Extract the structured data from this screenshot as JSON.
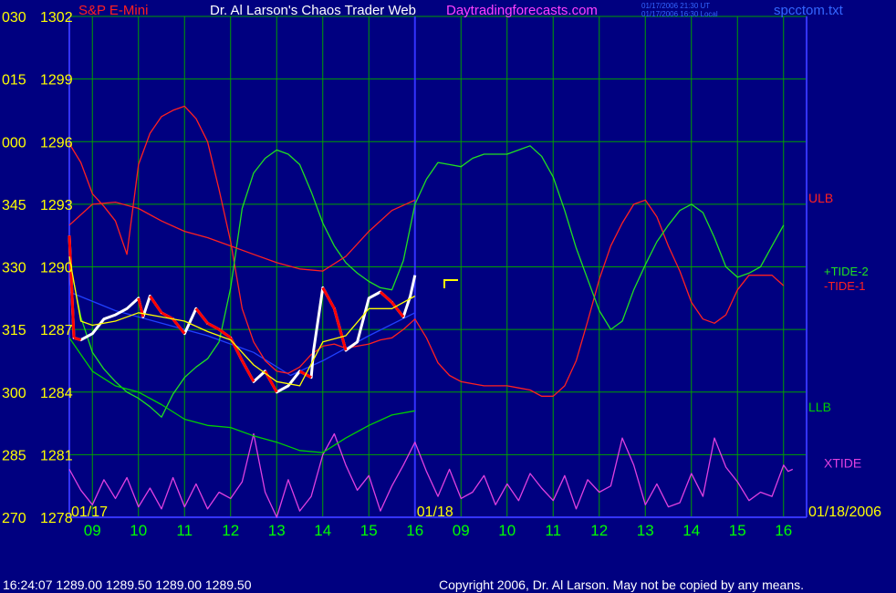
{
  "header": {
    "instrument": "S&P E-Mini",
    "title": "Dr. Al Larson's Chaos Trader Web",
    "site": "Daytradingforecasts.com",
    "stamp_ut": "01/17/2006 21:30 UT",
    "stamp_local": "01/17/2006 16:30 Local",
    "file": "spcctom.txt"
  },
  "footer": {
    "quote": "16:24:07   1289.00 1289.50 1289.00 1289.50",
    "copyright": "Copyright 2006, Dr. Al Larson. May not be copied by any means."
  },
  "colors": {
    "background": "#000080",
    "grid": "#00a000",
    "axis": "#3333ff",
    "price_up": "#ffffff",
    "price_down": "#ff0000",
    "ulb": "#ff2020",
    "llb": "#00d000",
    "tide_plus": "#20e020",
    "tide_minus": "#ff2020",
    "xtide": "#e040e0",
    "moving_avg": "#ffff00",
    "trend": "#2040ff",
    "label_yellow": "#ffff00",
    "label_white": "#ffffff",
    "label_green": "#00ff00",
    "title_magenta": "#ff40ff"
  },
  "chart_data": {
    "type": "line",
    "ylim": [
      1278,
      1302
    ],
    "y_ticks": [
      {
        "angle": "030",
        "price": "1302"
      },
      {
        "angle": "015",
        "price": "1299"
      },
      {
        "angle": "000",
        "price": "1296"
      },
      {
        "angle": "345",
        "price": "1293"
      },
      {
        "angle": "330",
        "price": "1290"
      },
      {
        "angle": "315",
        "price": "1287"
      },
      {
        "angle": "300",
        "price": "1284"
      },
      {
        "angle": "285",
        "price": "1281"
      },
      {
        "angle": "270",
        "price": "1278"
      }
    ],
    "xlim": [
      8.5,
      24.5
    ],
    "x_ticks": [
      {
        "x": 9,
        "label": "09"
      },
      {
        "x": 10,
        "label": "10"
      },
      {
        "x": 11,
        "label": "11"
      },
      {
        "x": 12,
        "label": "12"
      },
      {
        "x": 13,
        "label": "13"
      },
      {
        "x": 14,
        "label": "14"
      },
      {
        "x": 15,
        "label": "15"
      },
      {
        "x": 16,
        "label": "16"
      },
      {
        "x": 17,
        "label": "09"
      },
      {
        "x": 18,
        "label": "10"
      },
      {
        "x": 19,
        "label": "11"
      },
      {
        "x": 20,
        "label": "12"
      },
      {
        "x": 21,
        "label": "13"
      },
      {
        "x": 22,
        "label": "14"
      },
      {
        "x": 23,
        "label": "15"
      },
      {
        "x": 24,
        "label": "16"
      }
    ],
    "day_labels": [
      {
        "x": 8.5,
        "label": "01/17"
      },
      {
        "x": 16,
        "label": "01/18"
      },
      {
        "x": 24.5,
        "label": "01/18/2006"
      }
    ],
    "legend_labels": [
      {
        "name": "ULB",
        "y": 1293.3
      },
      {
        "name": "+TIDE-2",
        "y": 1289.8
      },
      {
        "name": "-TIDE-1",
        "y": 1289.4
      },
      {
        "name": "LLB",
        "y": 1283.3
      },
      {
        "name": "XTIDE",
        "y": 1280.6
      }
    ],
    "series": [
      {
        "name": "ULB",
        "x": [
          8.5,
          9,
          9.5,
          10,
          10.5,
          11,
          11.5,
          12,
          12.5,
          13,
          13.5,
          14,
          14.5,
          15,
          15.5,
          16
        ],
        "y": [
          1292.0,
          1293.0,
          1293.1,
          1292.8,
          1292.2,
          1291.7,
          1291.4,
          1291.0,
          1290.6,
          1290.2,
          1289.9,
          1289.8,
          1290.5,
          1291.7,
          1292.7,
          1293.2
        ]
      },
      {
        "name": "LLB",
        "x": [
          8.5,
          9,
          9.5,
          10,
          10.5,
          11,
          11.5,
          12,
          12.5,
          13,
          13.5,
          14,
          14.5,
          15,
          15.5,
          16
        ],
        "y": [
          1286.6,
          1285.0,
          1284.3,
          1284.0,
          1283.4,
          1282.7,
          1282.4,
          1282.3,
          1281.9,
          1281.6,
          1281.2,
          1281.1,
          1281.8,
          1282.4,
          1282.9,
          1283.1
        ]
      },
      {
        "name": "+TIDE-2",
        "x": [
          8.5,
          8.75,
          9,
          9.25,
          9.5,
          9.75,
          10,
          10.25,
          10.5,
          10.75,
          11,
          11.25,
          11.5,
          11.75,
          12,
          12.25,
          12.5,
          12.75,
          13,
          13.25,
          13.5,
          13.75,
          14,
          14.25,
          14.5,
          14.75,
          15,
          15.25,
          15.5,
          15.75,
          16,
          16.25,
          16.5,
          16.75,
          17,
          17.25,
          17.5,
          17.75,
          18,
          18.25,
          18.5,
          18.75,
          19,
          19.25,
          19.5,
          19.75,
          20,
          20.25,
          20.5,
          20.75,
          21,
          21.25,
          21.5,
          21.75,
          22,
          22.25,
          22.5,
          22.75,
          23,
          23.25,
          23.5,
          23.75,
          24
        ],
        "y": [
          1290.3,
          1287.6,
          1285.9,
          1285.1,
          1284.5,
          1284.0,
          1283.7,
          1283.3,
          1282.8,
          1283.9,
          1284.7,
          1285.2,
          1285.6,
          1286.4,
          1289.0,
          1292.8,
          1294.5,
          1295.2,
          1295.6,
          1295.4,
          1294.9,
          1293.6,
          1292.1,
          1291.0,
          1290.2,
          1289.7,
          1289.3,
          1289.0,
          1288.9,
          1290.3,
          1293.0,
          1294.2,
          1295.0,
          1294.9,
          1294.8,
          1295.2,
          1295.4,
          1295.4,
          1295.4,
          1295.6,
          1295.8,
          1295.3,
          1294.3,
          1292.7,
          1290.9,
          1289.4,
          1287.9,
          1287.0,
          1287.4,
          1288.9,
          1290.1,
          1291.2,
          1292.0,
          1292.7,
          1293.0,
          1292.6,
          1291.4,
          1290.0,
          1289.5,
          1289.7,
          1290.0,
          1291.0,
          1292.0
        ]
      },
      {
        "name": "-TIDE-1",
        "x": [
          8.5,
          8.75,
          9,
          9.25,
          9.5,
          9.75,
          10,
          10.25,
          10.5,
          10.75,
          11,
          11.25,
          11.5,
          11.75,
          12,
          12.25,
          12.5,
          12.75,
          13,
          13.25,
          13.5,
          13.75,
          14,
          14.25,
          14.5,
          14.75,
          15,
          15.25,
          15.5,
          15.75,
          16,
          16.25,
          16.5,
          16.75,
          17,
          17.25,
          17.5,
          17.75,
          18,
          18.25,
          18.5,
          18.75,
          19,
          19.25,
          19.5,
          19.75,
          20,
          20.25,
          20.5,
          20.75,
          21,
          21.25,
          21.5,
          21.75,
          22,
          22.25,
          22.5,
          22.75,
          23,
          23.25,
          23.5,
          23.75,
          24
        ],
        "y": [
          1295.9,
          1295.0,
          1293.5,
          1292.9,
          1292.2,
          1290.6,
          1294.9,
          1296.4,
          1297.2,
          1297.5,
          1297.7,
          1297.1,
          1296.0,
          1293.7,
          1291.2,
          1288.0,
          1286.4,
          1285.5,
          1285.0,
          1284.9,
          1285.2,
          1285.8,
          1286.2,
          1286.3,
          1286.1,
          1286.2,
          1286.3,
          1286.5,
          1286.6,
          1287.0,
          1287.5,
          1286.6,
          1285.4,
          1284.8,
          1284.5,
          1284.4,
          1284.3,
          1284.3,
          1284.3,
          1284.2,
          1284.1,
          1283.8,
          1283.8,
          1284.3,
          1285.5,
          1287.4,
          1289.4,
          1291.0,
          1292.1,
          1293.0,
          1293.2,
          1292.4,
          1291.0,
          1289.8,
          1288.3,
          1287.5,
          1287.3,
          1287.7,
          1288.9,
          1289.6,
          1289.6,
          1289.6,
          1289.1
        ]
      },
      {
        "name": "XTIDE",
        "x": [
          8.5,
          8.75,
          9,
          9.25,
          9.5,
          9.75,
          10,
          10.25,
          10.5,
          10.75,
          11,
          11.25,
          11.5,
          11.75,
          12,
          12.25,
          12.5,
          12.75,
          13,
          13.25,
          13.5,
          13.75,
          14,
          14.25,
          14.5,
          14.75,
          15,
          15.25,
          15.5,
          15.75,
          16,
          16.25,
          16.5,
          16.75,
          17,
          17.25,
          17.5,
          17.75,
          18,
          18.25,
          18.5,
          18.75,
          19,
          19.25,
          19.5,
          19.75,
          20,
          20.25,
          20.5,
          20.75,
          21,
          21.25,
          21.5,
          21.75,
          22,
          22.25,
          22.5,
          22.75,
          23,
          23.25,
          23.5,
          23.75,
          24,
          24.1,
          24.2
        ],
        "y": [
          1280.3,
          1279.3,
          1278.6,
          1279.8,
          1278.9,
          1279.9,
          1278.5,
          1279.4,
          1278.4,
          1279.9,
          1278.5,
          1279.6,
          1278.4,
          1279.2,
          1278.9,
          1279.7,
          1282.0,
          1279.2,
          1278.0,
          1279.8,
          1278.3,
          1279.0,
          1281.0,
          1282.0,
          1280.5,
          1279.3,
          1280.0,
          1278.3,
          1279.5,
          1280.5,
          1281.6,
          1280.2,
          1279.0,
          1280.3,
          1278.9,
          1279.2,
          1280.0,
          1278.6,
          1279.6,
          1278.8,
          1280.1,
          1279.4,
          1278.8,
          1280.0,
          1278.4,
          1279.8,
          1279.2,
          1279.5,
          1281.8,
          1280.5,
          1278.6,
          1279.6,
          1278.5,
          1278.7,
          1280.1,
          1279.0,
          1281.8,
          1280.4,
          1279.7,
          1278.8,
          1279.2,
          1279.0,
          1280.5,
          1280.2,
          1280.3
        ]
      },
      {
        "name": "price",
        "x": [
          8.5,
          8.6,
          8.75,
          9,
          9.25,
          9.5,
          9.75,
          10,
          10.1,
          10.25,
          10.5,
          10.75,
          11,
          11.25,
          11.5,
          11.75,
          12,
          12.25,
          12.5,
          12.75,
          13,
          13.25,
          13.5,
          13.75,
          13.8,
          14,
          14.25,
          14.5,
          14.75,
          15,
          15.25,
          15.5,
          15.75,
          15.9,
          16
        ],
        "y": [
          1291.5,
          1286.6,
          1286.5,
          1286.8,
          1287.5,
          1287.7,
          1288.0,
          1288.5,
          1287.6,
          1288.6,
          1287.8,
          1287.5,
          1286.8,
          1288.0,
          1287.3,
          1287.0,
          1286.6,
          1285.5,
          1284.5,
          1285.0,
          1284.0,
          1284.3,
          1285.0,
          1284.7,
          1286.0,
          1289.0,
          1288.0,
          1286.0,
          1286.4,
          1288.5,
          1288.8,
          1288.3,
          1287.6,
          1288.6,
          1289.6
        ]
      },
      {
        "name": "moving average",
        "x": [
          8.5,
          8.75,
          9,
          9.5,
          10,
          10.5,
          11,
          11.5,
          12,
          12.5,
          13,
          13.5,
          14,
          14.5,
          15,
          15.5,
          16
        ],
        "y": [
          1290.5,
          1287.4,
          1287.2,
          1287.4,
          1287.8,
          1287.6,
          1287.4,
          1286.9,
          1286.5,
          1285.3,
          1284.5,
          1284.3,
          1286.4,
          1286.7,
          1288.0,
          1288.0,
          1288.6
        ]
      },
      {
        "name": "trend",
        "x": [
          8.5,
          9.5,
          10.5,
          11.5,
          12.5,
          13.3,
          14.0,
          15.0,
          16.0
        ],
        "y": [
          1288.8,
          1287.9,
          1287.3,
          1286.7,
          1285.9,
          1284.8,
          1285.5,
          1286.7,
          1287.8
        ]
      }
    ]
  }
}
